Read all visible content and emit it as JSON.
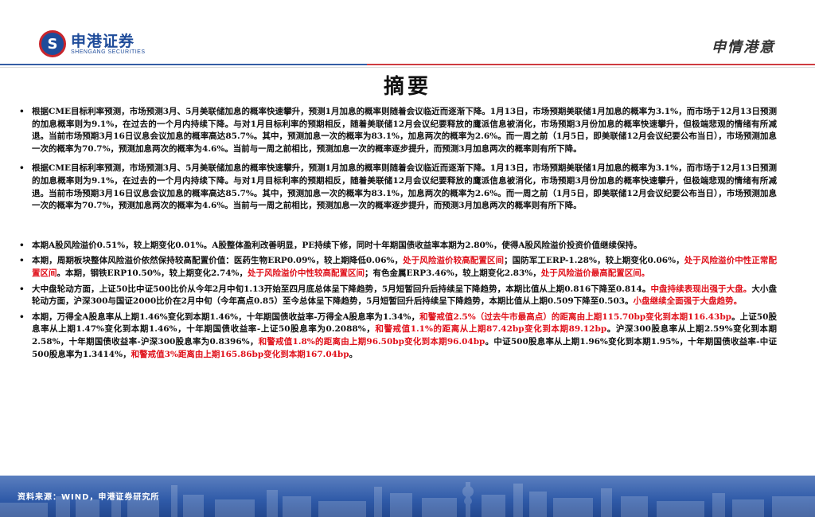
{
  "header": {
    "logo_mark": "S",
    "logo_cn": "申港证券",
    "logo_en": "SHENGANG SECURITIES",
    "brand": "申情港意"
  },
  "title": "摘要",
  "bullet_char": "•",
  "paragraphs": [
    {
      "segments": [
        {
          "text": "根据CME目标利率预测，市场预测3月、5月美联储加息的概率快速攀升，预测1月加息的概率则随着会议临近而逐渐下降。1月13日，市场预期美联储1月加息的概率为3.1%，而市场于12月13日预测的加息概率则为9.1%，在过去的一个月内持续下降。与对1月目标利率的预期相反，随着美联储12月会议纪要释放的鹰派信息被消化，市场预期3月份加息的概率快速攀升，但极端悲观的情绪有所减退。当前市场预期3月16日议息会议加息的概率高达85.7%。其中，预测加息一次的概率为83.1%，加息两次的概率为2.6%。而一周之前（1月5日，即美联储12月会议纪要公布当日），市场预测加息一次的概率为70.7%，预测加息两次的概率为4.6%。当前与一周之前相比，预测加息一次的概率逐步提升，而预测3月加息两次的概率则有所下降。",
          "red": false
        }
      ]
    },
    {
      "segments": [
        {
          "text": "根据CME目标利率预测，市场预测3月、5月美联储加息的概率快速攀升，预测1月加息的概率则随着会议临近而逐渐下降。1月13日，市场预期美联储1月加息的概率为3.1%，而市场于12月13日预测的加息概率则为9.1%，在过去的一个月内持续下降。与对1月目标利率的预期相反，随着美联储12月会议纪要释放的鹰派信息被消化，市场预期3月份加息的概率快速攀升，但极端悲观的情绪有所减退。当前市场预期3月16日议息会议加息的概率高达85.7%。其中，预测加息一次的概率为83.1%，加息两次的概率为2.6%。而一周之前（1月5日，即美联储12月会议纪要公布当日），市场预测加息一次的概率为70.7%，预测加息两次的概率为4.6%。当前与一周之前相比，预测加息一次的概率逐步提升，而预测3月加息两次的概率则有所下降。",
          "red": false
        }
      ]
    },
    {
      "segments": [
        {
          "text": "本期A股风险溢价0.51%，较上期变化0.01%。A股整体盈利改善明显，PE持续下修，同时十年期国债收益率本期为2.80%，使得A股风险溢价投资价值继续保持。",
          "red": false
        }
      ]
    },
    {
      "segments": [
        {
          "text": "本期，周期板块整体风险溢价依然保持较高配置价值：医药生物ERP0.09%，较上期降低0.06%，",
          "red": false
        },
        {
          "text": "处于风险溢价较高配置区间",
          "red": true
        },
        {
          "text": "；国防军工ERP-1.28%，较上期变化0.06%，",
          "red": false
        },
        {
          "text": "处于风险溢价中性正常配置区间",
          "red": true
        },
        {
          "text": "。本期，钢铁ERP10.50%，较上期变化2.74%，",
          "red": false
        },
        {
          "text": "处于风险溢价中性较高配置区间",
          "red": true
        },
        {
          "text": "；有色金属ERP3.46%，较上期变化2.83%，",
          "red": false
        },
        {
          "text": "处于风险溢价最高配置区间。",
          "red": true
        }
      ]
    },
    {
      "segments": [
        {
          "text": "大中盘轮动方面，上证50比中证500比价从今年2月中旬1.13开始至四月底总体呈下降趋势，5月短暂回升后持续呈下降趋势，本期比值从上期0.816下降至0.814。",
          "red": false
        },
        {
          "text": "中盘持续表现出强于大盘。",
          "red": true
        },
        {
          "text": "大小盘轮动方面，沪深300与国证2000比价在2月中旬（今年高点0.85）至今总体呈下降趋势，5月短暂回升后持续呈下降趋势，本期比值从上期0.509下降至0.503。",
          "red": false
        },
        {
          "text": "小盘继续全面强于大盘趋势。",
          "red": true
        }
      ]
    },
    {
      "segments": [
        {
          "text": "本期，万得全A股息率从上期1.46%变化到本期1.46%，十年期国债收益率-万得全A股息率为1.34%，",
          "red": false
        },
        {
          "text": "和警戒值2.5%（过去牛市最高点）的距离由上期115.70bp变化到本期116.43bp",
          "red": true
        },
        {
          "text": "。上证50股息率从上期1.47%变化到本期1.46%，十年期国债收益率-上证50股息率为0.2088%，",
          "red": false
        },
        {
          "text": "和警戒值1.1%的距离从上期87.42bp变化到本期89.12bp",
          "red": true
        },
        {
          "text": "。沪深300股息率从上期2.59%变化到本期2.58%，十年期国债收益率-沪深300股息率为0.8396%，",
          "red": false
        },
        {
          "text": "和警戒值1.8%的距离由上期96.50bp变化到本期96.04bp",
          "red": true
        },
        {
          "text": "。中证500股息率从上期1.96%变化到本期1.95%，十年期国债收益率-中证500股息率为1.3414%，",
          "red": false
        },
        {
          "text": "和警戒值3%距离由上期165.86bp变化到本期167.04bp",
          "red": true
        },
        {
          "text": "。",
          "red": false
        }
      ]
    }
  ],
  "footer": {
    "source": "资料来源：WIND，申港证券研究所"
  },
  "colors": {
    "brand_blue": "#1f4c9a",
    "brand_red": "#c9252c",
    "highlight_red": "#e0101a",
    "footer_blue": "#2f5aa8"
  }
}
